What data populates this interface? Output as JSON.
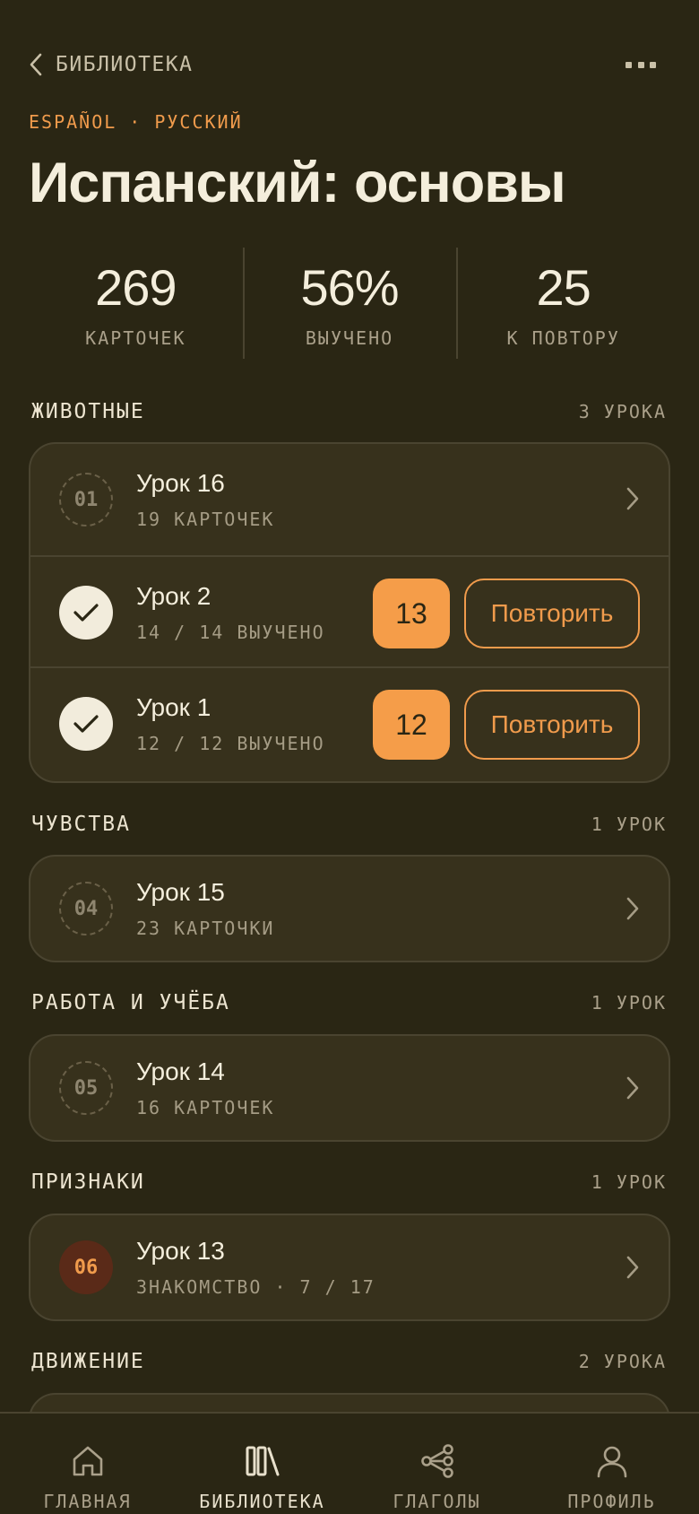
{
  "header": {
    "back_label": "БИБЛИОТЕКА",
    "languages": [
      "ESPAÑOL",
      "·",
      "РУССКИЙ"
    ],
    "title": "Испанский: основы"
  },
  "stats": [
    {
      "value": "269",
      "label": "КАРТОЧЕК"
    },
    {
      "value": "56%",
      "label": "ВЫУЧЕНО"
    },
    {
      "value": "25",
      "label": "К ПОВТОРУ"
    }
  ],
  "sections": [
    {
      "name": "ЖИВОТНЫЕ",
      "count": "3 УРОКА",
      "lessons": [
        {
          "badge": "01",
          "title": "Урок 16",
          "subtitle": "19 КАРТОЧЕК"
        },
        {
          "title": "Урок 2",
          "subtitle": "14 / 14 ВЫУЧЕНО",
          "due": "13",
          "action": "Повторить"
        },
        {
          "title": "Урок 1",
          "subtitle": "12 / 12 ВЫУЧЕНО",
          "due": "12",
          "action": "Повторить"
        }
      ]
    },
    {
      "name": "ЧУВСТВА",
      "count": "1 УРОК",
      "lessons": [
        {
          "badge": "04",
          "title": "Урок 15",
          "subtitle": "23 КАРТОЧКИ"
        }
      ]
    },
    {
      "name": "РАБОТА И УЧЁБА",
      "count": "1 УРОК",
      "lessons": [
        {
          "badge": "05",
          "title": "Урок 14",
          "subtitle": "16 КАРТОЧЕК"
        }
      ]
    },
    {
      "name": "ПРИЗНАКИ",
      "count": "1 УРОК",
      "lessons": [
        {
          "badge": "06",
          "title": "Урок 13",
          "subtitle": "ЗНАКОМСТВО · 7 / 17"
        }
      ]
    },
    {
      "name": "ДВИЖЕНИЕ",
      "count": "2 УРОКА"
    }
  ],
  "nav": [
    {
      "label": "ГЛАВНАЯ",
      "icon": "home-icon"
    },
    {
      "label": "БИБЛИОТЕКА",
      "icon": "library-icon",
      "active": true
    },
    {
      "label": "ГЛАГОЛЫ",
      "icon": "share-nodes-icon"
    },
    {
      "label": "ПРОФИЛЬ",
      "icon": "profile-icon"
    }
  ],
  "colors": {
    "background": "#2a2614",
    "card": "#37311c",
    "accent": "#f59d49",
    "text": "#f4eedc"
  }
}
